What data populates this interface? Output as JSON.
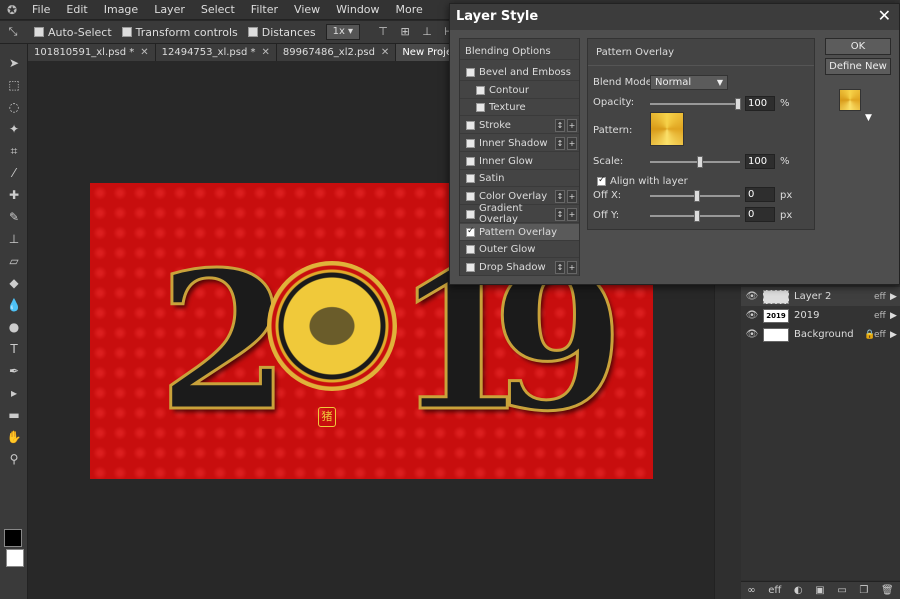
{
  "menu": {
    "items": [
      "File",
      "Edit",
      "Image",
      "Layer",
      "Select",
      "Filter",
      "View",
      "Window",
      "More"
    ]
  },
  "options": {
    "auto_select": "Auto-Select",
    "transform_controls": "Transform controls",
    "distances": "Distances",
    "zoom": "1x"
  },
  "tabs": [
    {
      "label": "101810591_xl.psd *"
    },
    {
      "label": "12494753_xl.psd *"
    },
    {
      "label": "89967486_xl2.psd"
    },
    {
      "label": "New Project.psd *"
    }
  ],
  "canvas": {
    "digits": [
      "2",
      "1",
      "9"
    ],
    "seal": "猪"
  },
  "dialog": {
    "title": "Layer Style",
    "close": "✕",
    "styles": {
      "blending": "Blending Options",
      "bevel": "Bevel and Emboss",
      "contour": "Contour",
      "texture": "Texture",
      "stroke": "Stroke",
      "inner_shadow": "Inner Shadow",
      "inner_glow": "Inner Glow",
      "satin": "Satin",
      "color_overlay": "Color Overlay",
      "gradient_overlay": "Gradient Overlay",
      "pattern_overlay": "Pattern Overlay",
      "outer_glow": "Outer Glow",
      "drop_shadow": "Drop Shadow"
    },
    "panel": {
      "title": "Pattern Overlay",
      "blend_mode_label": "Blend Mode:",
      "blend_mode": "Normal",
      "opacity_label": "Opacity:",
      "opacity": "100",
      "pattern_label": "Pattern:",
      "scale_label": "Scale:",
      "scale": "100",
      "percent": "%",
      "align_label": "Align with layer",
      "offx_label": "Off X:",
      "offx": "0",
      "offy_label": "Off Y:",
      "offy": "0",
      "px": "px"
    },
    "ok": "OK",
    "define_new": "Define New"
  },
  "layers": [
    {
      "name": "Layer 2",
      "thumb": "",
      "eff": "eff"
    },
    {
      "name": "2019",
      "thumb": "2019",
      "eff": "eff"
    },
    {
      "name": "Background",
      "thumb": "",
      "eff": "eff"
    }
  ],
  "layer_footer": {
    "eff": "eff"
  },
  "colors": {
    "accent_red": "#c80e0e",
    "gold": "#e0b23a"
  }
}
